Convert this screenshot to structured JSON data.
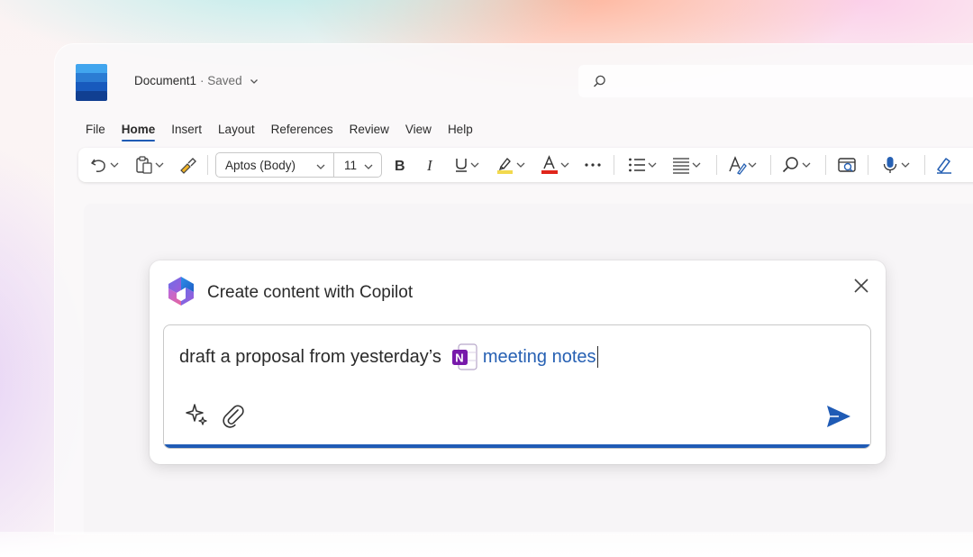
{
  "document": {
    "title": "Document1",
    "status": "· Saved"
  },
  "search": {
    "placeholder": ""
  },
  "ribbon": {
    "tabs": [
      {
        "label": "File"
      },
      {
        "label": "Home"
      },
      {
        "label": "Insert"
      },
      {
        "label": "Layout"
      },
      {
        "label": "References"
      },
      {
        "label": "Review"
      },
      {
        "label": "View"
      },
      {
        "label": "Help"
      }
    ],
    "active_tab": "Home"
  },
  "toolbar": {
    "font_name": "Aptos (Body)",
    "font_size": "11",
    "highlight_color": "#f2d94e",
    "font_color": "#e0261b",
    "icons": [
      "undo-icon",
      "paste-icon",
      "format-painter-icon",
      "bold-icon",
      "italic-icon",
      "underline-icon",
      "highlight-icon",
      "font-color-icon",
      "more-icon",
      "bullets-icon",
      "align-icon",
      "styles-icon",
      "find-icon",
      "review-icon",
      "dictate-icon",
      "editor-icon"
    ]
  },
  "copilot": {
    "title": "Create content with Copilot",
    "prompt_text": "draft a proposal from yesterday’s",
    "reference_text": "meeting notes",
    "accent_color": "#1f5bb5",
    "reference_color": "#2660b3"
  },
  "colors": {
    "word_blue": "#185abd",
    "onenote_purple": "#7719aa"
  }
}
